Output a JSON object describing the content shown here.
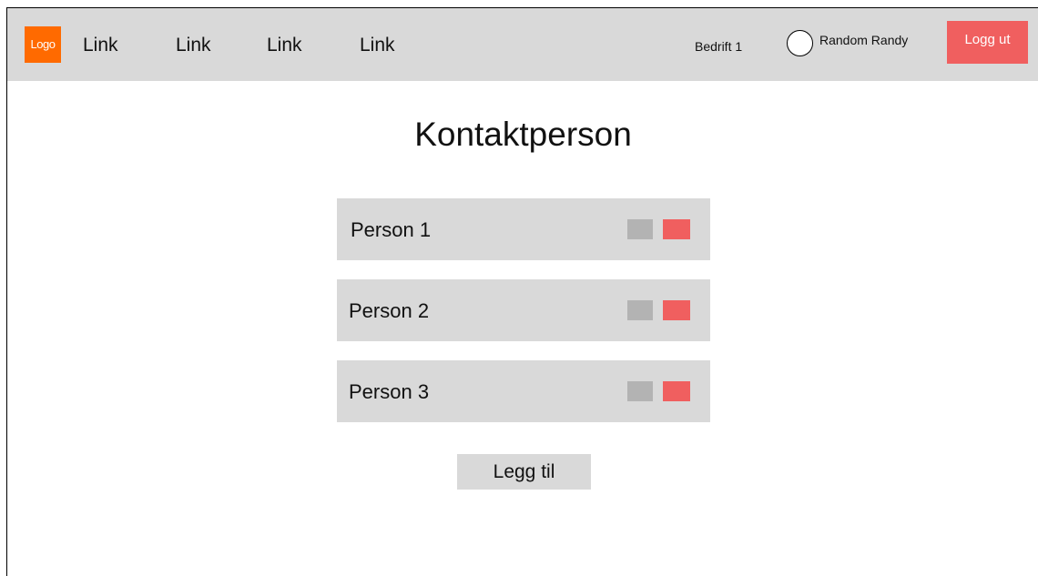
{
  "header": {
    "logo_text": "Logo",
    "nav_links": [
      {
        "label": "Link"
      },
      {
        "label": "Link"
      },
      {
        "label": "Link"
      },
      {
        "label": "Link"
      }
    ],
    "company": "Bedrift 1",
    "user_name": "Random Randy",
    "logout_label": "Logg ut"
  },
  "main": {
    "title": "Kontaktperson",
    "persons": [
      {
        "name": "Person 1"
      },
      {
        "name": "Person 2"
      },
      {
        "name": "Person 3"
      }
    ],
    "add_label": "Legg til"
  },
  "colors": {
    "topbar_bg": "#d9d9d9",
    "logo_bg": "#ff6a00",
    "accent_red": "#f05f5f",
    "edit_gray": "#b3b3b3",
    "row_bg": "#d9d9d9"
  },
  "icons": {
    "avatar": "user-avatar-circle",
    "edit": "edit-button-gray",
    "delete": "delete-button-red"
  }
}
